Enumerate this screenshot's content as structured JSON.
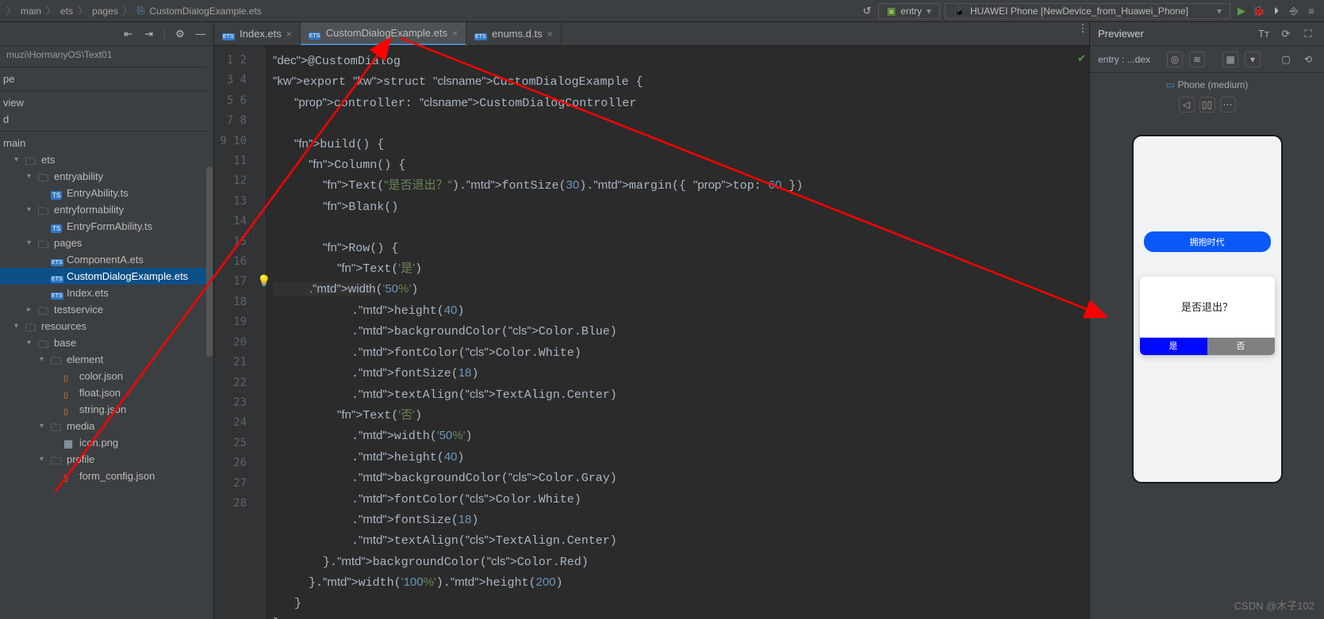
{
  "breadcrumb": [
    "main",
    "ets",
    "pages",
    "CustomDialogExample.ets"
  ],
  "toolbar": {
    "module": "entry",
    "device": "HUAWEI Phone [NewDevice_from_Huawei_Phone]"
  },
  "sidebar": {
    "path": "muzi\\HormanyOS\\Text01",
    "sections": {
      "pe": "pe",
      "view": "view",
      "d": "d",
      "main": "main"
    },
    "items": [
      {
        "label": "ets",
        "depth": 1,
        "type": "folder",
        "open": true
      },
      {
        "label": "entryability",
        "depth": 2,
        "type": "folder",
        "open": true
      },
      {
        "label": "EntryAbility.ts",
        "depth": 3,
        "type": "ts"
      },
      {
        "label": "entryformability",
        "depth": 2,
        "type": "folder",
        "open": true
      },
      {
        "label": "EntryFormAbility.ts",
        "depth": 3,
        "type": "ts"
      },
      {
        "label": "pages",
        "depth": 2,
        "type": "folder",
        "open": true
      },
      {
        "label": "ComponentA.ets",
        "depth": 3,
        "type": "ets"
      },
      {
        "label": "CustomDialogExample.ets",
        "depth": 3,
        "type": "ets",
        "sel": true
      },
      {
        "label": "Index.ets",
        "depth": 3,
        "type": "ets"
      },
      {
        "label": "testservice",
        "depth": 2,
        "type": "folder",
        "open": false
      },
      {
        "label": "resources",
        "depth": 1,
        "type": "folder",
        "open": true
      },
      {
        "label": "base",
        "depth": 2,
        "type": "folder",
        "open": true
      },
      {
        "label": "element",
        "depth": 3,
        "type": "folder",
        "open": true
      },
      {
        "label": "color.json",
        "depth": 4,
        "type": "json"
      },
      {
        "label": "float.json",
        "depth": 4,
        "type": "json"
      },
      {
        "label": "string.json",
        "depth": 4,
        "type": "json"
      },
      {
        "label": "media",
        "depth": 3,
        "type": "folder",
        "open": true
      },
      {
        "label": "icon.png",
        "depth": 4,
        "type": "img"
      },
      {
        "label": "profile",
        "depth": 3,
        "type": "folder",
        "open": true
      },
      {
        "label": "form_config.json",
        "depth": 4,
        "type": "json"
      }
    ]
  },
  "tabs": [
    {
      "label": "Index.ets",
      "active": false
    },
    {
      "label": "CustomDialogExample.ets",
      "active": true
    },
    {
      "label": "enums.d.ts",
      "active": false
    }
  ],
  "editor": {
    "lineStart": 1,
    "lineEnd": 28,
    "bulbLine": 12,
    "code": [
      "@CustomDialog",
      "export struct CustomDialogExample {",
      "   controller: CustomDialogController",
      "",
      "   build() {",
      "     Column() {",
      "       Text(\"是否退出？\").fontSize(30).margin({ top: 60 })",
      "       Blank()",
      "",
      "       Row() {",
      "         Text('是')",
      "           .width('50%')",
      "           .height(40)",
      "           .backgroundColor(Color.Blue)",
      "           .fontColor(Color.White)",
      "           .fontSize(18)",
      "           .textAlign(TextAlign.Center)",
      "         Text('否')",
      "           .width('50%')",
      "           .height(40)",
      "           .backgroundColor(Color.Gray)",
      "           .fontColor(Color.White)",
      "           .fontSize(18)",
      "           .textAlign(TextAlign.Center)",
      "       }.backgroundColor(Color.Red)",
      "     }.width('100%').height(200)",
      "   }",
      "}"
    ]
  },
  "preview": {
    "title": "Previewer",
    "entry": "entry : ...dex",
    "device": "Phone (medium)",
    "phone": {
      "topBtn": "拥抱时代",
      "dialogTitle": "是否退出？",
      "yes": "是",
      "no": "否"
    }
  },
  "watermark": "CSDN @木子102"
}
